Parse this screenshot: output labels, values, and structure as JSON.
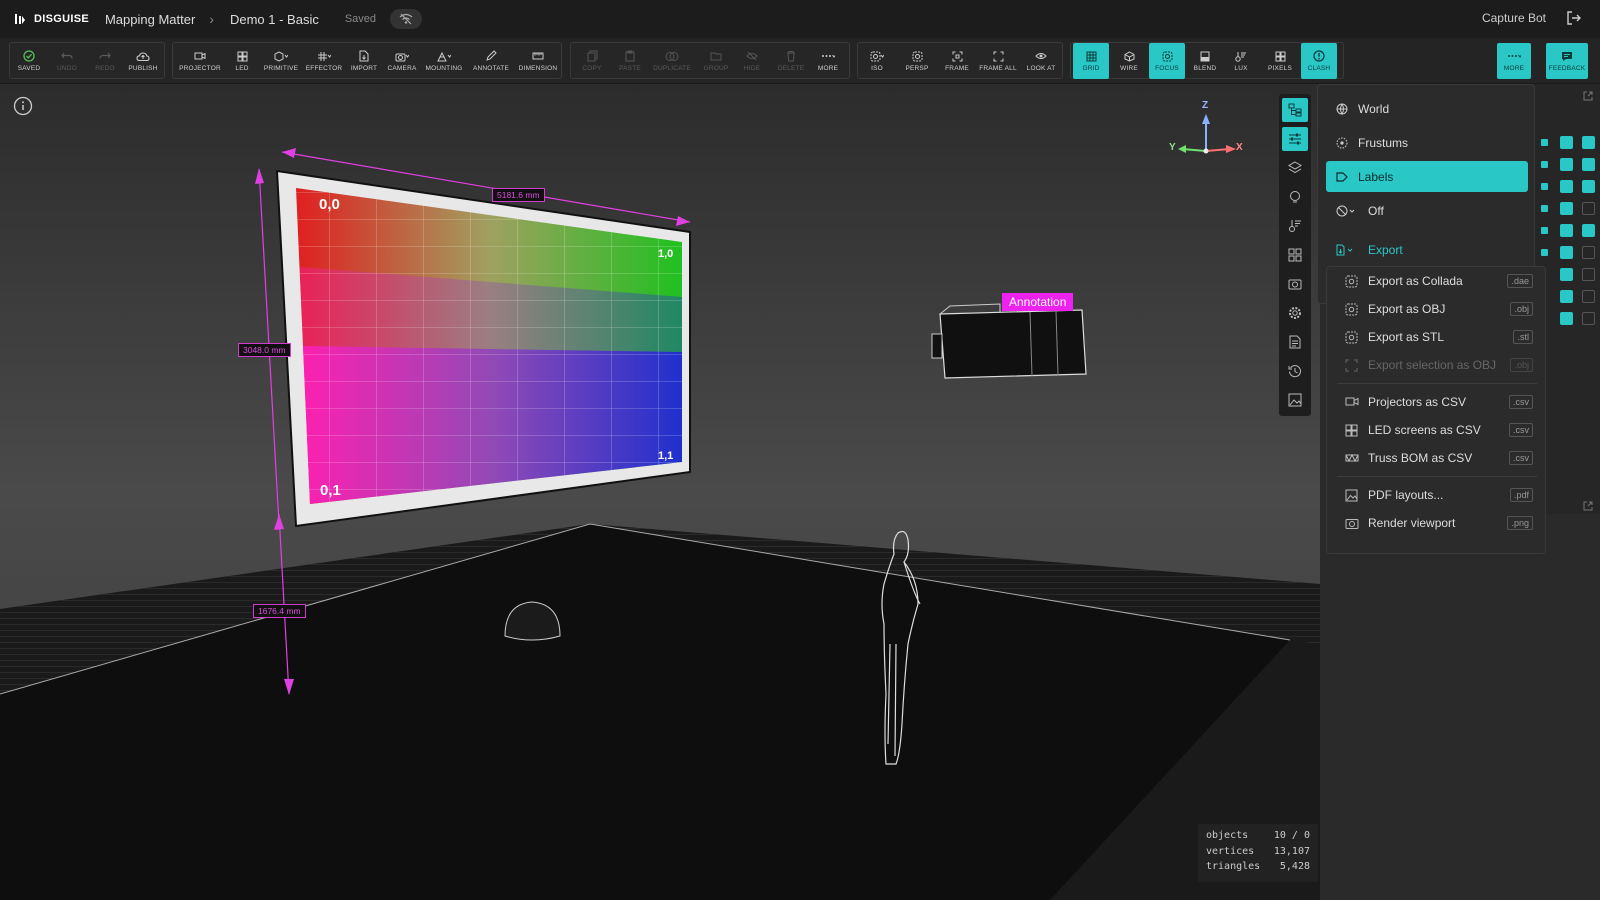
{
  "app": {
    "brand": "DISGUISE",
    "project": "Mapping Matter",
    "scene": "Demo 1 - Basic",
    "save_state": "Saved",
    "user": "Capture Bot"
  },
  "toolbar": {
    "file": [
      {
        "label": "SAVED",
        "icon": "check-circle-icon"
      },
      {
        "label": "UNDO",
        "icon": "undo-icon",
        "disabled": true
      },
      {
        "label": "REDO",
        "icon": "redo-icon",
        "disabled": true
      },
      {
        "label": "PUBLISH",
        "icon": "cloud-upload-icon"
      }
    ],
    "create": [
      {
        "label": "PROJECTOR"
      },
      {
        "label": "LED"
      },
      {
        "label": "PRIMITIVE"
      },
      {
        "label": "EFFECTOR"
      },
      {
        "label": "IMPORT"
      },
      {
        "label": "CAMERA"
      },
      {
        "label": "MOUNTING"
      },
      {
        "label": "ANNOTATE"
      },
      {
        "label": "DIMENSION"
      }
    ],
    "edit": [
      {
        "label": "COPY"
      },
      {
        "label": "PASTE"
      },
      {
        "label": "DUPLICATE"
      },
      {
        "label": "GROUP"
      },
      {
        "label": "HIDE"
      },
      {
        "label": "DELETE"
      },
      {
        "label": "MORE"
      }
    ],
    "view": [
      {
        "label": "ISO"
      },
      {
        "label": "PERSP"
      },
      {
        "label": "FRAME"
      },
      {
        "label": "FRAME ALL"
      },
      {
        "label": "LOOK AT"
      }
    ],
    "display": [
      {
        "label": "GRID",
        "active": true
      },
      {
        "label": "WIRE"
      },
      {
        "label": "FOCUS",
        "active": true
      },
      {
        "label": "BLEND"
      },
      {
        "label": "LUX"
      },
      {
        "label": "PIXELS"
      },
      {
        "label": "CLASH",
        "active": true
      }
    ],
    "more_label": "MORE",
    "feedback_label": "FEEDBACK"
  },
  "viewport": {
    "dimensions": {
      "width": "5181.6 mm",
      "height": "3048.0 mm",
      "elevation": "1676.4 mm"
    },
    "screen_labels": {
      "tl": "0,0",
      "tr": "1,0",
      "bl": "0,1",
      "br": "1,1"
    },
    "annotation": "Annotation",
    "gizmo": {
      "z": "Z",
      "y": "Y",
      "x": "X"
    },
    "stats": {
      "objects_label": "objects",
      "objects": "10 / 0",
      "vertices_label": "vertices",
      "vertices": "13,107",
      "triangles_label": "triangles",
      "triangles": "5,428"
    }
  },
  "menu": {
    "world": "World",
    "frustums": "Frustums",
    "labels": "Labels",
    "off": "Off",
    "export": "Export"
  },
  "export_menu": {
    "collada": {
      "label": "Export as Collada",
      "ext": ".dae"
    },
    "obj": {
      "label": "Export as OBJ",
      "ext": ".obj"
    },
    "stl": {
      "label": "Export as STL",
      "ext": ".stl"
    },
    "sel_obj": {
      "label": "Export selection as OBJ",
      "ext": ".obj"
    },
    "projectors": {
      "label": "Projectors as CSV",
      "ext": ".csv"
    },
    "led": {
      "label": "LED screens as CSV",
      "ext": ".csv"
    },
    "truss": {
      "label": "Truss BOM as CSV",
      "ext": ".csv"
    },
    "pdf": {
      "label": "PDF layouts...",
      "ext": ".pdf"
    },
    "render": {
      "label": "Render viewport",
      "ext": ".png"
    }
  },
  "colors": {
    "accent": "#2ac7c7",
    "dimension": "#e040e0",
    "annotation": "#ee22ee",
    "background": "#2a2a2a"
  }
}
